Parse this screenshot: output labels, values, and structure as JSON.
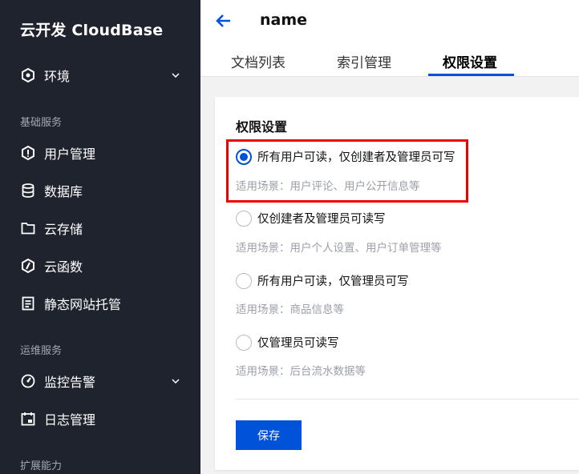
{
  "sidebar": {
    "brand": "云开发 CloudBase",
    "env": {
      "label": "环境",
      "icon": "hexagon-icon"
    },
    "sections": [
      {
        "title": "基础服务",
        "items": [
          {
            "label": "用户管理",
            "icon": "user-shield-icon"
          },
          {
            "label": "数据库",
            "icon": "database-icon"
          },
          {
            "label": "云存储",
            "icon": "folder-icon"
          },
          {
            "label": "云函数",
            "icon": "function-icon"
          },
          {
            "label": "静态网站托管",
            "icon": "document-icon"
          }
        ]
      },
      {
        "title": "运维服务",
        "items": [
          {
            "label": "监控告警",
            "icon": "gauge-icon"
          },
          {
            "label": "日志管理",
            "icon": "calendar-log-icon"
          }
        ]
      },
      {
        "title": "扩展能力",
        "items": []
      }
    ]
  },
  "header": {
    "title": "name",
    "tabs": [
      {
        "label": "文档列表",
        "active": false
      },
      {
        "label": "索引管理",
        "active": false
      },
      {
        "label": "权限设置",
        "active": true
      }
    ]
  },
  "permissions": {
    "title": "权限设置",
    "options": [
      {
        "label": "所有用户可读，仅创建者及管理员可写",
        "desc": "适用场景：用户评论、用户公开信息等",
        "checked": true
      },
      {
        "label": "仅创建者及管理员可读写",
        "desc": "适用场景：用户个人设置、用户订单管理等",
        "checked": false
      },
      {
        "label": "所有用户可读，仅管理员可写",
        "desc": "适用场景：商品信息等",
        "checked": false
      },
      {
        "label": "仅管理员可读写",
        "desc": "适用场景：后台流水数据等",
        "checked": false
      }
    ],
    "save_label": "保存"
  },
  "colors": {
    "sidebar_bg": "#1f232e",
    "accent": "#0052d9",
    "highlight": "#ee0000"
  }
}
